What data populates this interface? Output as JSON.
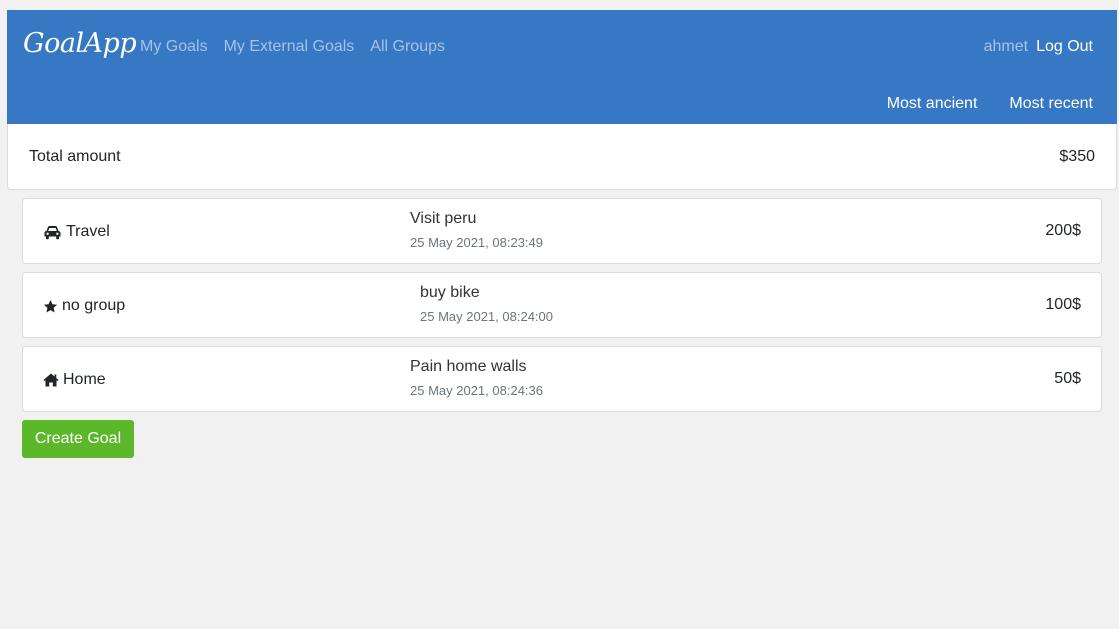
{
  "header": {
    "brand": "GoalApp",
    "nav_links": [
      "My Goals",
      "My External Goals",
      "All Groups"
    ],
    "user_name": "ahmet",
    "logout_label": "Log Out",
    "sort_options": [
      "Most ancient",
      "Most recent"
    ]
  },
  "total": {
    "label": "Total amount",
    "value": "$350"
  },
  "goals": [
    {
      "group": "Travel",
      "group_icon": "car-icon",
      "title": "Visit peru",
      "date": "25 May 2021, 08:23:49",
      "amount": "200$"
    },
    {
      "group": "no group",
      "group_icon": "star-icon",
      "title": "buy bike",
      "date": "25 May 2021, 08:24:00",
      "amount": "100$"
    },
    {
      "group": "Home",
      "group_icon": "home-icon",
      "title": "Pain home walls",
      "date": "25 May 2021, 08:24:36",
      "amount": "50$"
    }
  ],
  "create_button_label": "Create Goal",
  "colors": {
    "navbar": "#3778c5",
    "create_button": "#5cb72b",
    "background": "#f0f1f0"
  }
}
